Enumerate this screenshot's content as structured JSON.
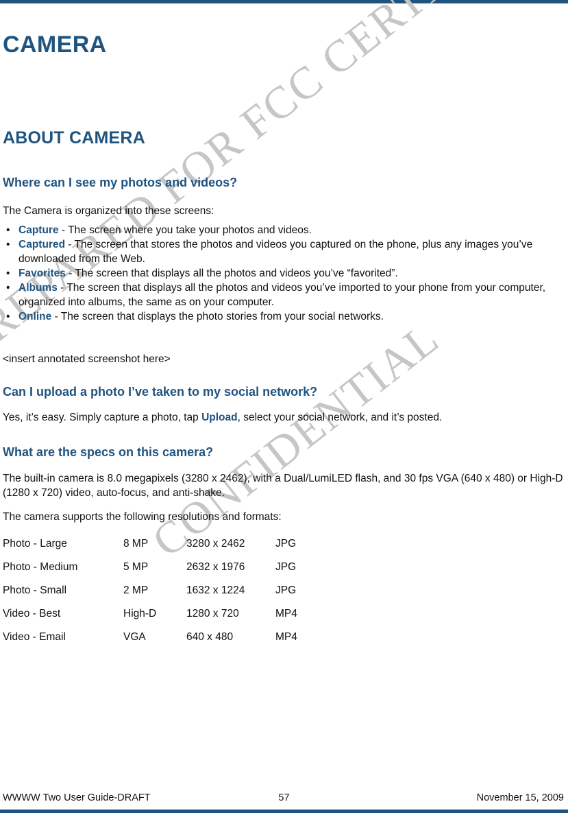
{
  "page": {
    "chapter_title": "CAMERA",
    "section_title": "ABOUT CAMERA",
    "accent_color": "#1f5480",
    "text_color": "#111111",
    "watermark_color": "#c6c6c6"
  },
  "watermark": {
    "line1": "PREPARED FOR FCC CERTIFICATION",
    "line2": "CONFIDENTIAL"
  },
  "subheads": {
    "where": "Where can I see my photos and videos?",
    "upload": "Can I upload a photo I’ve taken to my social network?",
    "specs": "What are the specs on this camera?"
  },
  "paragraphs": {
    "intro": "The Camera is organized into these screens:",
    "insert_note": "<insert annotated screenshot here>",
    "yes_prefix": "Yes, it’s easy. Simply capture a photo, tap ",
    "yes_term": "Upload",
    "yes_suffix": ", select your social network, and it’s posted.",
    "specs_body": "The built-in camera is 8.0 megapixels (3280 x 2462), with a Dual/LumiLED flash, and 30 fps VGA (640 x 480) or High-D (1280 x 720) video, auto-focus, and anti-shake.",
    "supports": "The camera supports the following resolutions and formats:"
  },
  "screens": [
    {
      "term": "Capture",
      "description": " - The screen where you take your photos and videos."
    },
    {
      "term": "Captured",
      "description": " - The screen that stores the photos and videos you captured on the phone, plus any images you’ve downloaded from the Web."
    },
    {
      "term": "Favorites",
      "description": " - The screen that displays all the photos and videos you’ve “favorited”."
    },
    {
      "term": "Albums",
      "description": " - The screen that displays all the photos and videos you’ve imported to your phone from your computer, organized into albums, the same as on your computer."
    },
    {
      "term": "Online",
      "description": " - The screen that displays the photo stories from your social networks."
    }
  ],
  "spec_table": {
    "rows": [
      {
        "mode": "Photo - Large",
        "quality": "8 MP",
        "resolution": "3280 x 2462",
        "format": "JPG"
      },
      {
        "mode": "Photo - Medium",
        "quality": "5 MP",
        "resolution": "2632 x 1976",
        "format": "JPG"
      },
      {
        "mode": "Photo - Small",
        "quality": "2 MP",
        "resolution": "1632 x 1224",
        "format": "JPG"
      },
      {
        "mode": "Video - Best",
        "quality": "High-D",
        "resolution": "1280 x 720",
        "format": "MP4"
      },
      {
        "mode": "Video - Email",
        "quality": "VGA",
        "resolution": "640 x 480",
        "format": "MP4"
      }
    ]
  },
  "footer": {
    "left": "WWWW Two User Guide-DRAFT",
    "page_number": "57",
    "right": "November 15, 2009"
  }
}
